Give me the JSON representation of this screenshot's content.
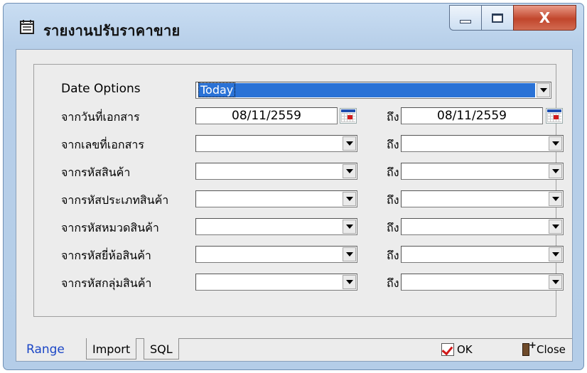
{
  "window": {
    "title": "รายงานปรับราคาขาย",
    "close_glyph": "X"
  },
  "form": {
    "date_options": {
      "label": "Date Options",
      "value": "Today"
    },
    "to_label": "ถึง",
    "doc_date": {
      "label": "จากวันที่เอกสาร",
      "from": "08/11/2559",
      "to": "08/11/2559"
    },
    "rows": [
      {
        "label": "จากเลขที่เอกสาร"
      },
      {
        "label": "จากรหัสสินค้า"
      },
      {
        "label": "จากรหัสประเภทสินค้า"
      },
      {
        "label": "จากรหัสหมวดสินค้า"
      },
      {
        "label": "จากรหัสยี่ห้อสินค้า"
      },
      {
        "label": "จากรหัสกลุ่มสินค้า"
      }
    ]
  },
  "tabs": [
    {
      "label": "Range",
      "active": true
    },
    {
      "label": "Import",
      "active": false
    },
    {
      "label": "SQL",
      "active": false
    }
  ],
  "buttons": {
    "ok": "OK",
    "close": "Close"
  },
  "colors": {
    "accent": "#2a72d6",
    "active_tab": "#1b46c6",
    "close_button": "#c1462c"
  },
  "icons": [
    "report-icon",
    "minimize-icon",
    "maximize-icon",
    "close-icon",
    "calendar-icon",
    "dropdown-arrow-icon",
    "ok-check-icon",
    "exit-door-icon"
  ]
}
